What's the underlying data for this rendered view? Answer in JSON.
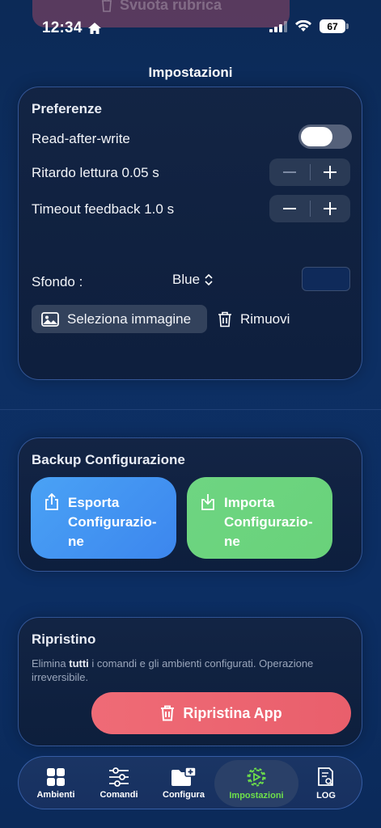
{
  "ghost": {
    "label": "Svuota rubrica"
  },
  "status": {
    "time": "12:34",
    "battery": "67"
  },
  "header": {
    "title": "Impostazioni"
  },
  "preferences": {
    "title": "Preferenze",
    "read_after_write": "Read-after-write",
    "read_after_write_on": false,
    "read_delay": "Ritardo lettura 0.05 s",
    "timeout": "Timeout feedback 1.0 s",
    "background_label": "Sfondo :",
    "background_value": "Blue",
    "background_color": "#0f2a5a",
    "select_image": "Seleziona immagine",
    "remove": "Rimuovi"
  },
  "backup": {
    "title": "Backup Configurazione",
    "export_line1": "Esporta",
    "export_line2": "Configurazio-",
    "export_line3": "ne",
    "import_line1": "Importa",
    "import_line2": "Configurazio-",
    "import_line3": "ne"
  },
  "reset": {
    "title": "Ripristino",
    "desc_pre": "Elimina ",
    "desc_bold": "tutti",
    "desc_post": " i comandi e gli ambienti configurati. Operazione irreversibile.",
    "button": "Ripristina App"
  },
  "tabs": [
    {
      "label": "Ambienti",
      "icon": "grid-icon"
    },
    {
      "label": "Comandi",
      "icon": "sliders-icon"
    },
    {
      "label": "Configura",
      "icon": "folder-plus-icon"
    },
    {
      "label": "Impostazioni",
      "icon": "gear-icon",
      "active": true
    },
    {
      "label": "LOG",
      "icon": "log-search-icon"
    }
  ],
  "colors": {
    "accent_green": "#6ee04a",
    "export_blue": "#4aa2f5",
    "import_green": "#6ed582",
    "reset_red": "#ef6b76"
  }
}
